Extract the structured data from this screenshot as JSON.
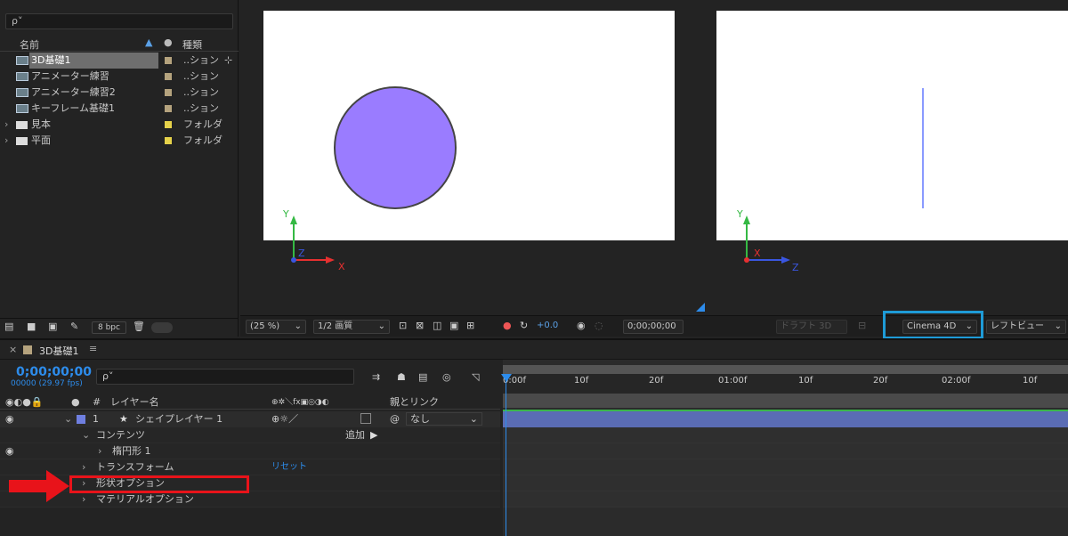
{
  "project": {
    "search_icon": "search-icon",
    "search_glyph": "ρ˅",
    "col_name": "名前",
    "col_type": "種類",
    "items": [
      {
        "name": "3D基礎1",
        "type": "..ション",
        "label_color": "#b5a37e",
        "kind": "comp",
        "selected": true
      },
      {
        "name": "アニメーター練習",
        "type": "..ション",
        "label_color": "#b5a37e",
        "kind": "comp"
      },
      {
        "name": "アニメーター練習2",
        "type": "..ション",
        "label_color": "#b5a37e",
        "kind": "comp"
      },
      {
        "name": "キーフレーム基礎1",
        "type": "..ション",
        "label_color": "#b5a37e",
        "kind": "comp"
      },
      {
        "name": "見本",
        "type": "フォルダ",
        "label_color": "#e6d24a",
        "kind": "folder"
      },
      {
        "name": "平面",
        "type": "フォルダ",
        "label_color": "#e6d24a",
        "kind": "folder"
      }
    ],
    "bpc": "8 bpc"
  },
  "viewer": {
    "zoom": "(25 %)",
    "quality": "1/2 画質",
    "exposure": "+0.0",
    "timecode": "0;00;00;00",
    "draft3d": "ドラフト 3D",
    "renderer": "Cinema 4D",
    "view": "レフトビュー",
    "axis_y": "Y",
    "axis_z": "Z",
    "axis_x": "X",
    "circle_color": "#9a7cff",
    "highlight_color": "#1e9bd7"
  },
  "timeline": {
    "tab_title": "3D基礎1",
    "menu_glyph": "≡",
    "timecode": "0;00;00;00",
    "fps": "00000 (29.97 fps)",
    "search_glyph": "ρ˅",
    "col_hash": "#",
    "col_layer_name": "レイヤー名",
    "col_parent": "親とリンク",
    "layer": {
      "index": "1",
      "name": "シェイプレイヤー 1",
      "parent": "なし",
      "color": "#6f7fe0"
    },
    "rows": {
      "contents": "コンテンツ",
      "add": "追加",
      "ellipse": "楕円形 1",
      "transform": "トランスフォーム",
      "reset": "リセット",
      "geometry": "形状オプション",
      "material": "マテリアルオプション"
    },
    "ruler": [
      "0:00f",
      "10f",
      "20f",
      "01:00f",
      "10f",
      "20f",
      "02:00f",
      "10f"
    ],
    "annotation_color": "#e8131a"
  }
}
